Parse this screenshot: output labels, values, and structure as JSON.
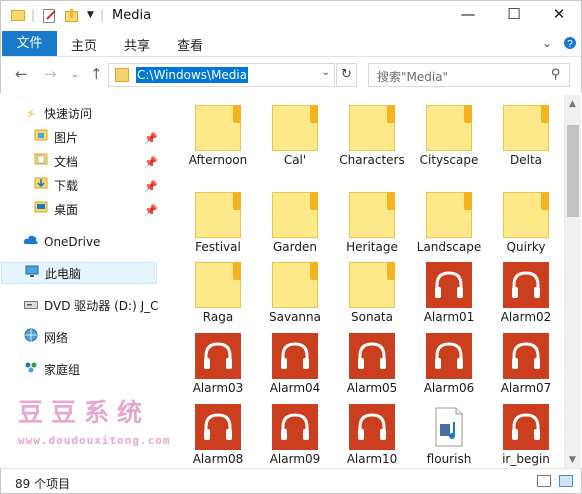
{
  "window": {
    "title": "Media",
    "quick_access_toolbar": [
      "folder-icon",
      "properties-icon",
      "new-folder-icon",
      "customize-dropdown"
    ],
    "controls": {
      "minimize": "—",
      "maximize": "☐",
      "close": "✕"
    }
  },
  "ribbon": {
    "file_tab": "文件",
    "tabs": [
      "主页",
      "共享",
      "查看"
    ],
    "collapse_icon": "chevron-down-icon",
    "help_icon": "help-icon"
  },
  "address_bar": {
    "path": "C:\\Windows\\Media",
    "search_placeholder": "搜索\"Media\""
  },
  "nav_pane": {
    "quick_access": {
      "label": "快速访问",
      "icon": "lightning-icon",
      "color": "#f0c419"
    },
    "pinned": [
      {
        "label": "图片",
        "icon": "pictures-folder-icon"
      },
      {
        "label": "文档",
        "icon": "documents-folder-icon"
      },
      {
        "label": "下载",
        "icon": "downloads-folder-icon"
      },
      {
        "label": "桌面",
        "icon": "desktop-folder-icon"
      }
    ],
    "onedrive": {
      "label": "OneDrive",
      "icon": "cloud-icon"
    },
    "this_pc": {
      "label": "此电脑",
      "icon": "computer-icon",
      "selected": true
    },
    "dvd": {
      "label": "DVD 驱动器 (D:) J_C",
      "icon": "dvd-icon"
    },
    "network": {
      "label": "网络",
      "icon": "network-icon"
    },
    "homegroup": {
      "label": "家庭组",
      "icon": "homegroup-icon"
    }
  },
  "files": [
    {
      "name": "Afternoon",
      "type": "folder"
    },
    {
      "name": "Cal'",
      "type": "folder"
    },
    {
      "name": "Characters",
      "type": "folder"
    },
    {
      "name": "Cityscape",
      "type": "folder"
    },
    {
      "name": "Delta",
      "type": "folder"
    },
    {
      "name": "Festival",
      "type": "folder"
    },
    {
      "name": "Garden",
      "type": "folder"
    },
    {
      "name": "Heritage",
      "type": "folder"
    },
    {
      "name": "Landscape",
      "type": "folder"
    },
    {
      "name": "Quirky",
      "type": "folder"
    },
    {
      "name": "Raga",
      "type": "folder"
    },
    {
      "name": "Savanna",
      "type": "folder"
    },
    {
      "name": "Sonata",
      "type": "folder"
    },
    {
      "name": "Alarm01",
      "type": "audio"
    },
    {
      "name": "Alarm02",
      "type": "audio"
    },
    {
      "name": "Alarm03",
      "type": "audio"
    },
    {
      "name": "Alarm04",
      "type": "audio"
    },
    {
      "name": "Alarm05",
      "type": "audio"
    },
    {
      "name": "Alarm06",
      "type": "audio"
    },
    {
      "name": "Alarm07",
      "type": "audio"
    },
    {
      "name": "Alarm08",
      "type": "audio"
    },
    {
      "name": "Alarm09",
      "type": "audio"
    },
    {
      "name": "Alarm10",
      "type": "audio"
    },
    {
      "name": "flourish",
      "type": "midi"
    },
    {
      "name": "ir_begin",
      "type": "audio"
    }
  ],
  "status_bar": {
    "item_count": "89 个项目"
  },
  "watermark": {
    "text": "豆豆系统",
    "url": "www.doudouxitong.com"
  },
  "colors": {
    "accent": "#1979ca",
    "folder": "#fde88a",
    "folder_tab": "#f6b21f",
    "audio_tile": "#cb3f1f",
    "watermark": "#e6a8cf"
  }
}
